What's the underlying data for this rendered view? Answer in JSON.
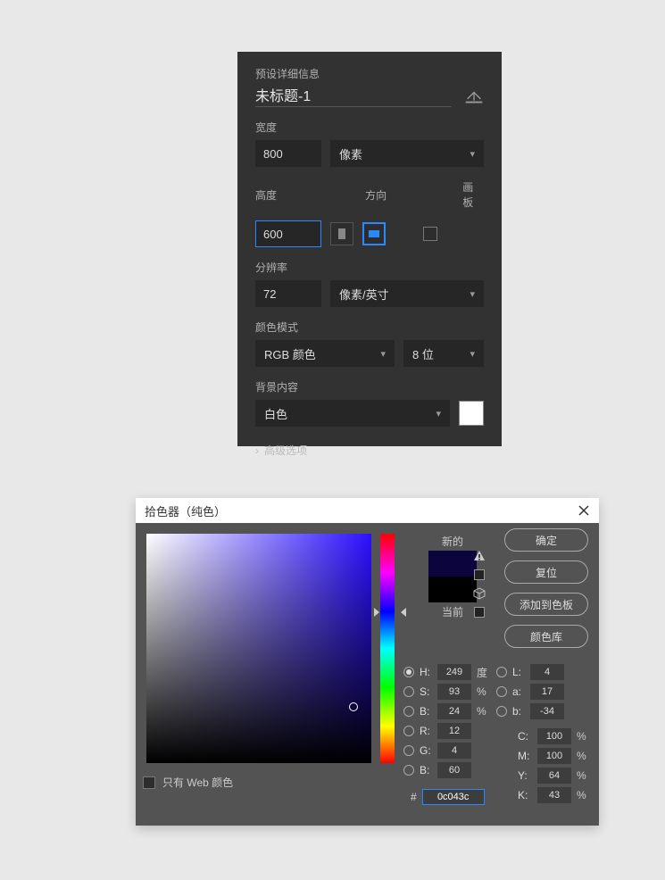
{
  "preset": {
    "header": "预设详细信息",
    "title": "未标题-1",
    "width_label": "宽度",
    "width_value": "800",
    "width_unit": "像素",
    "height_label": "高度",
    "height_value": "600",
    "orientation_label": "方向",
    "artboard_label": "画板",
    "resolution_label": "分辨率",
    "resolution_value": "72",
    "resolution_unit": "像素/英寸",
    "color_mode_label": "颜色模式",
    "color_mode_value": "RGB 颜色",
    "bit_depth": "8 位",
    "bg_label": "背景内容",
    "bg_value": "白色",
    "advanced": "高级选项"
  },
  "picker": {
    "title": "拾色器（纯色）",
    "new_label": "新的",
    "current_label": "当前",
    "btn_ok": "确定",
    "btn_reset": "复位",
    "btn_add_swatch": "添加到色板",
    "btn_lib": "颜色库",
    "web_only": "只有 Web 颜色",
    "H": {
      "label": "H:",
      "val": "249",
      "unit": "度"
    },
    "S": {
      "label": "S:",
      "val": "93",
      "unit": "%"
    },
    "B": {
      "label": "B:",
      "val": "24",
      "unit": "%"
    },
    "L": {
      "label": "L:",
      "val": "4"
    },
    "a": {
      "label": "a:",
      "val": "17"
    },
    "b2": {
      "label": "b:",
      "val": "-34"
    },
    "R": {
      "label": "R:",
      "val": "12"
    },
    "G": {
      "label": "G:",
      "val": "4"
    },
    "Bch": {
      "label": "B:",
      "val": "60"
    },
    "C": {
      "label": "C:",
      "val": "100",
      "unit": "%"
    },
    "M": {
      "label": "M:",
      "val": "100",
      "unit": "%"
    },
    "Y": {
      "label": "Y:",
      "val": "64",
      "unit": "%"
    },
    "K": {
      "label": "K:",
      "val": "43",
      "unit": "%"
    },
    "hex_label": "#",
    "hex_value": "0c043c"
  }
}
